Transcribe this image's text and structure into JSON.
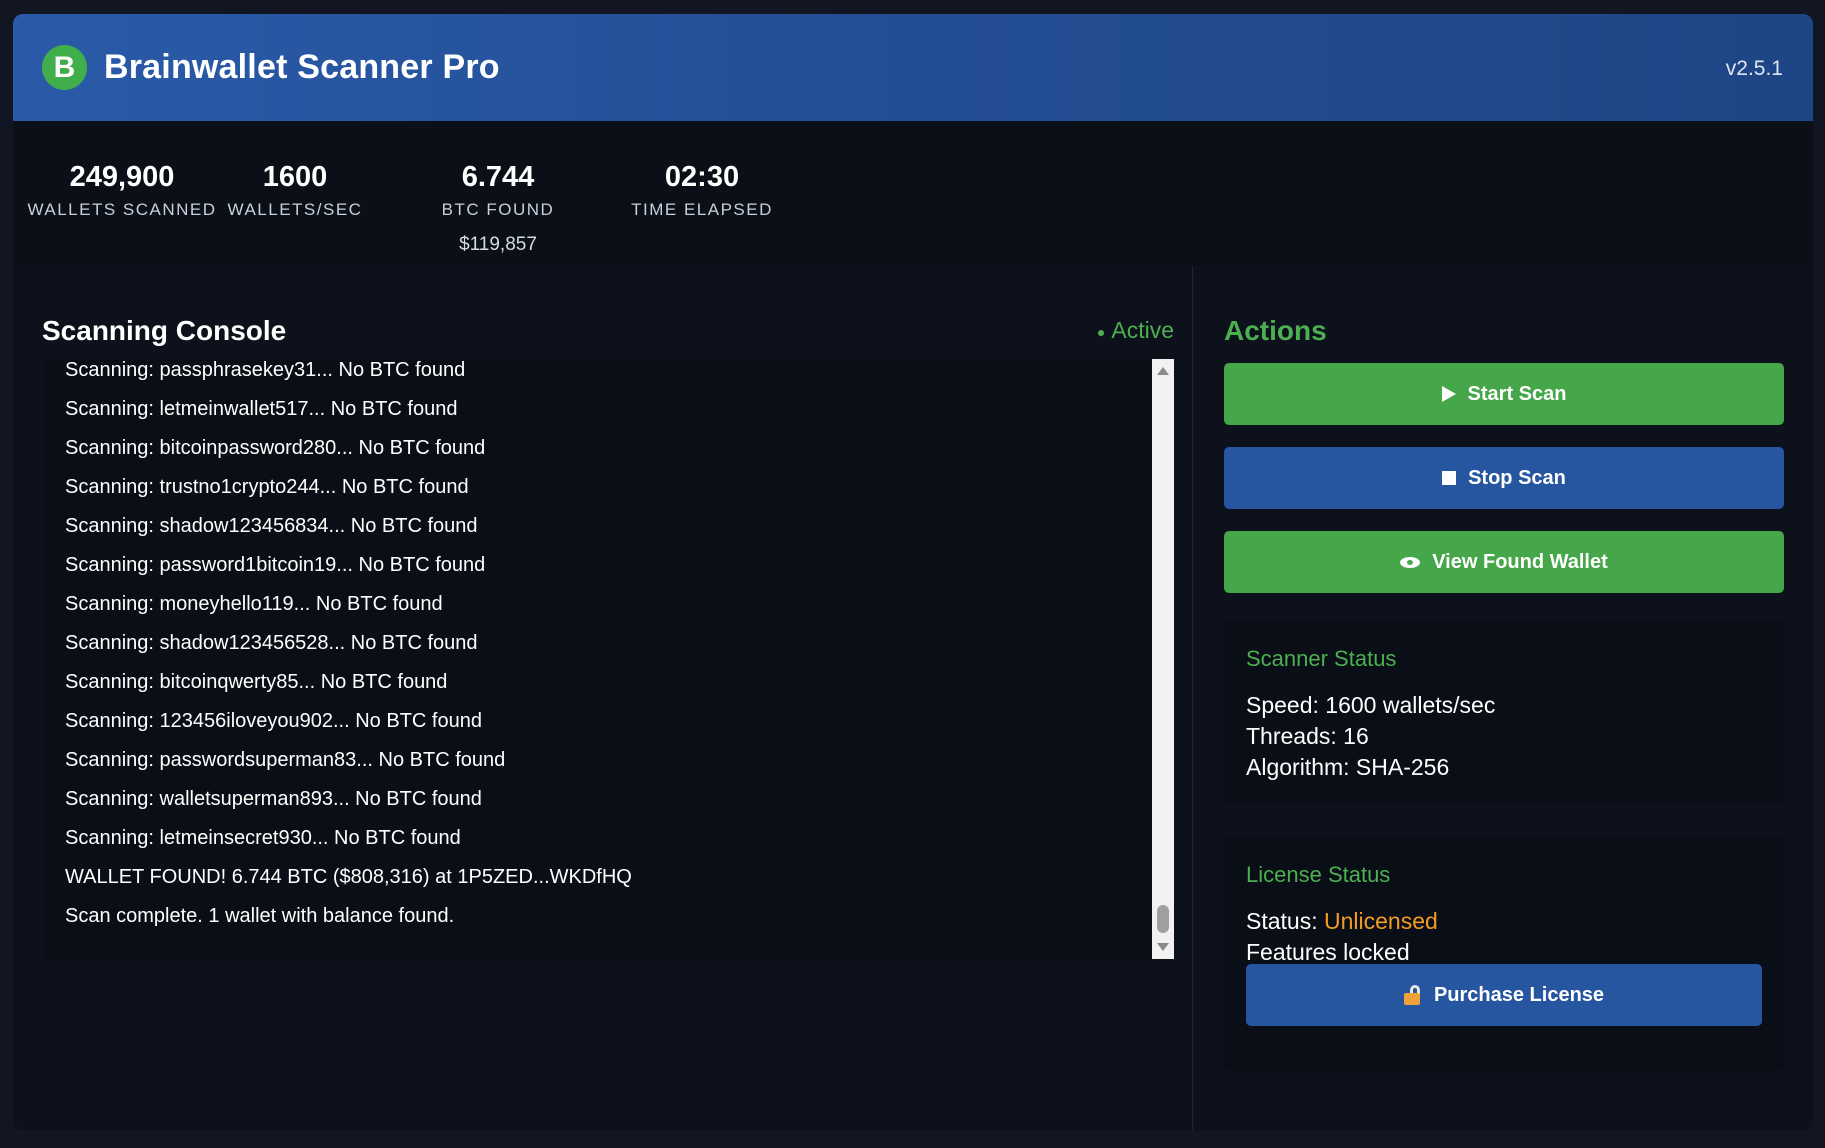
{
  "header": {
    "logo_letter": "B",
    "title": "Brainwallet Scanner Pro",
    "version": "v2.5.1"
  },
  "stats": [
    {
      "value": "249,900",
      "label": "WALLETS SCANNED",
      "sub": ""
    },
    {
      "value": "1600",
      "label": "WALLETS/SEC",
      "sub": ""
    },
    {
      "value": "6.744",
      "label": "BTC FOUND",
      "sub": "$119,857"
    },
    {
      "value": "02:30",
      "label": "TIME ELAPSED",
      "sub": ""
    }
  ],
  "console": {
    "title": "Scanning Console",
    "status_dot": "●",
    "status": "Active",
    "lines": [
      "Scanning: passphrasekey31... No BTC found",
      "Scanning: letmeinwallet517... No BTC found",
      "Scanning: bitcoinpassword280... No BTC found",
      "Scanning: trustno1crypto244... No BTC found",
      "Scanning: shadow123456834... No BTC found",
      "Scanning: password1bitcoin19... No BTC found",
      "Scanning: moneyhello119... No BTC found",
      "Scanning: shadow123456528... No BTC found",
      "Scanning: bitcoinqwerty85... No BTC found",
      "Scanning: 123456iloveyou902... No BTC found",
      "Scanning: passwordsuperman83... No BTC found",
      "Scanning: walletsuperman893... No BTC found",
      "Scanning: letmeinsecret930... No BTC found",
      "WALLET FOUND! 6.744 BTC ($808,316) at 1P5ZED...WKDfHQ",
      "Scan complete. 1 wallet with balance found."
    ]
  },
  "actions": {
    "title": "Actions",
    "start_label": "Start Scan",
    "stop_label": "Stop Scan",
    "view_label": "View Found Wallet"
  },
  "scanner_status": {
    "title": "Scanner Status",
    "speed": "Speed: 1600 wallets/sec",
    "threads": "Threads: 16",
    "algorithm": "Algorithm: SHA-256"
  },
  "license_status": {
    "title": "License Status",
    "status_label": "Status: ",
    "status_value": "Unlicensed",
    "features": "Features locked",
    "purchase_label": "Purchase License"
  },
  "colors": {
    "accent_green": "#4caf50",
    "button_green": "#45a64a",
    "button_blue": "#2756a0",
    "warning_orange": "#f39c24",
    "background": "#0d111b"
  }
}
